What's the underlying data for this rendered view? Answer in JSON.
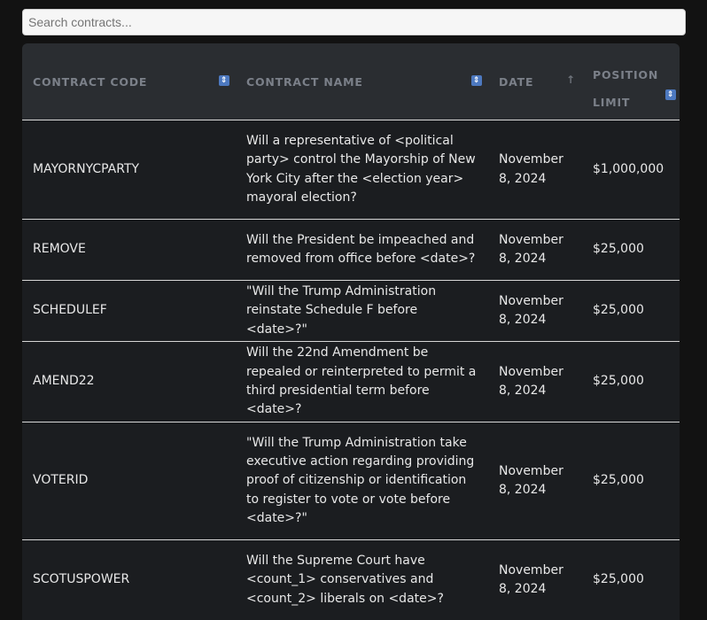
{
  "search": {
    "placeholder": "Search contracts..."
  },
  "columns": [
    {
      "label": "CONTRACT CODE",
      "sort_icon": "sort-toggle-icon"
    },
    {
      "label": "CONTRACT NAME",
      "sort_icon": "sort-toggle-icon"
    },
    {
      "label": "DATE",
      "sort_icon": "sort-ascending-icon"
    },
    {
      "label_line1": "POSITION",
      "label_line2": "LIMIT",
      "sort_icon": "sort-toggle-icon"
    }
  ],
  "rows": [
    {
      "code": "MAYORNYCPARTY",
      "name": "Will a representative of <political party> control the Mayorship of New York City after the <election year> mayoral election?",
      "date": "November 8, 2024",
      "limit": "$1,000,000"
    },
    {
      "code": "REMOVE",
      "name": "Will the President be impeached and removed from office before <date>?",
      "date": "November 8, 2024",
      "limit": "$25,000"
    },
    {
      "code": "SCHEDULEF",
      "name": "\"Will the Trump Administration reinstate Schedule F before <date>?\"",
      "date": "November 8, 2024",
      "limit": "$25,000"
    },
    {
      "code": "AMEND22",
      "name": "Will the 22nd Amendment be repealed or reinterpreted to permit a third presidential term before <date>?",
      "date": "November 8, 2024",
      "limit": "$25,000"
    },
    {
      "code": "VOTERID",
      "name": "\"Will the Trump Administration take executive action regarding providing proof of citizenship or identification to register to vote or vote before <date>?\"",
      "date": "November 8, 2024",
      "limit": "$25,000"
    },
    {
      "code": "SCOTUSPOWER",
      "name": "Will the Supreme Court have <count_1> conservatives and <count_2> liberals on <date>?",
      "date": "November 8, 2024",
      "limit": "$25,000"
    }
  ],
  "colors": {
    "background": "#121212",
    "header_bg": "#2a2d31",
    "row_bg": "#1b1d20",
    "sort_accent": "#4d79c0"
  }
}
